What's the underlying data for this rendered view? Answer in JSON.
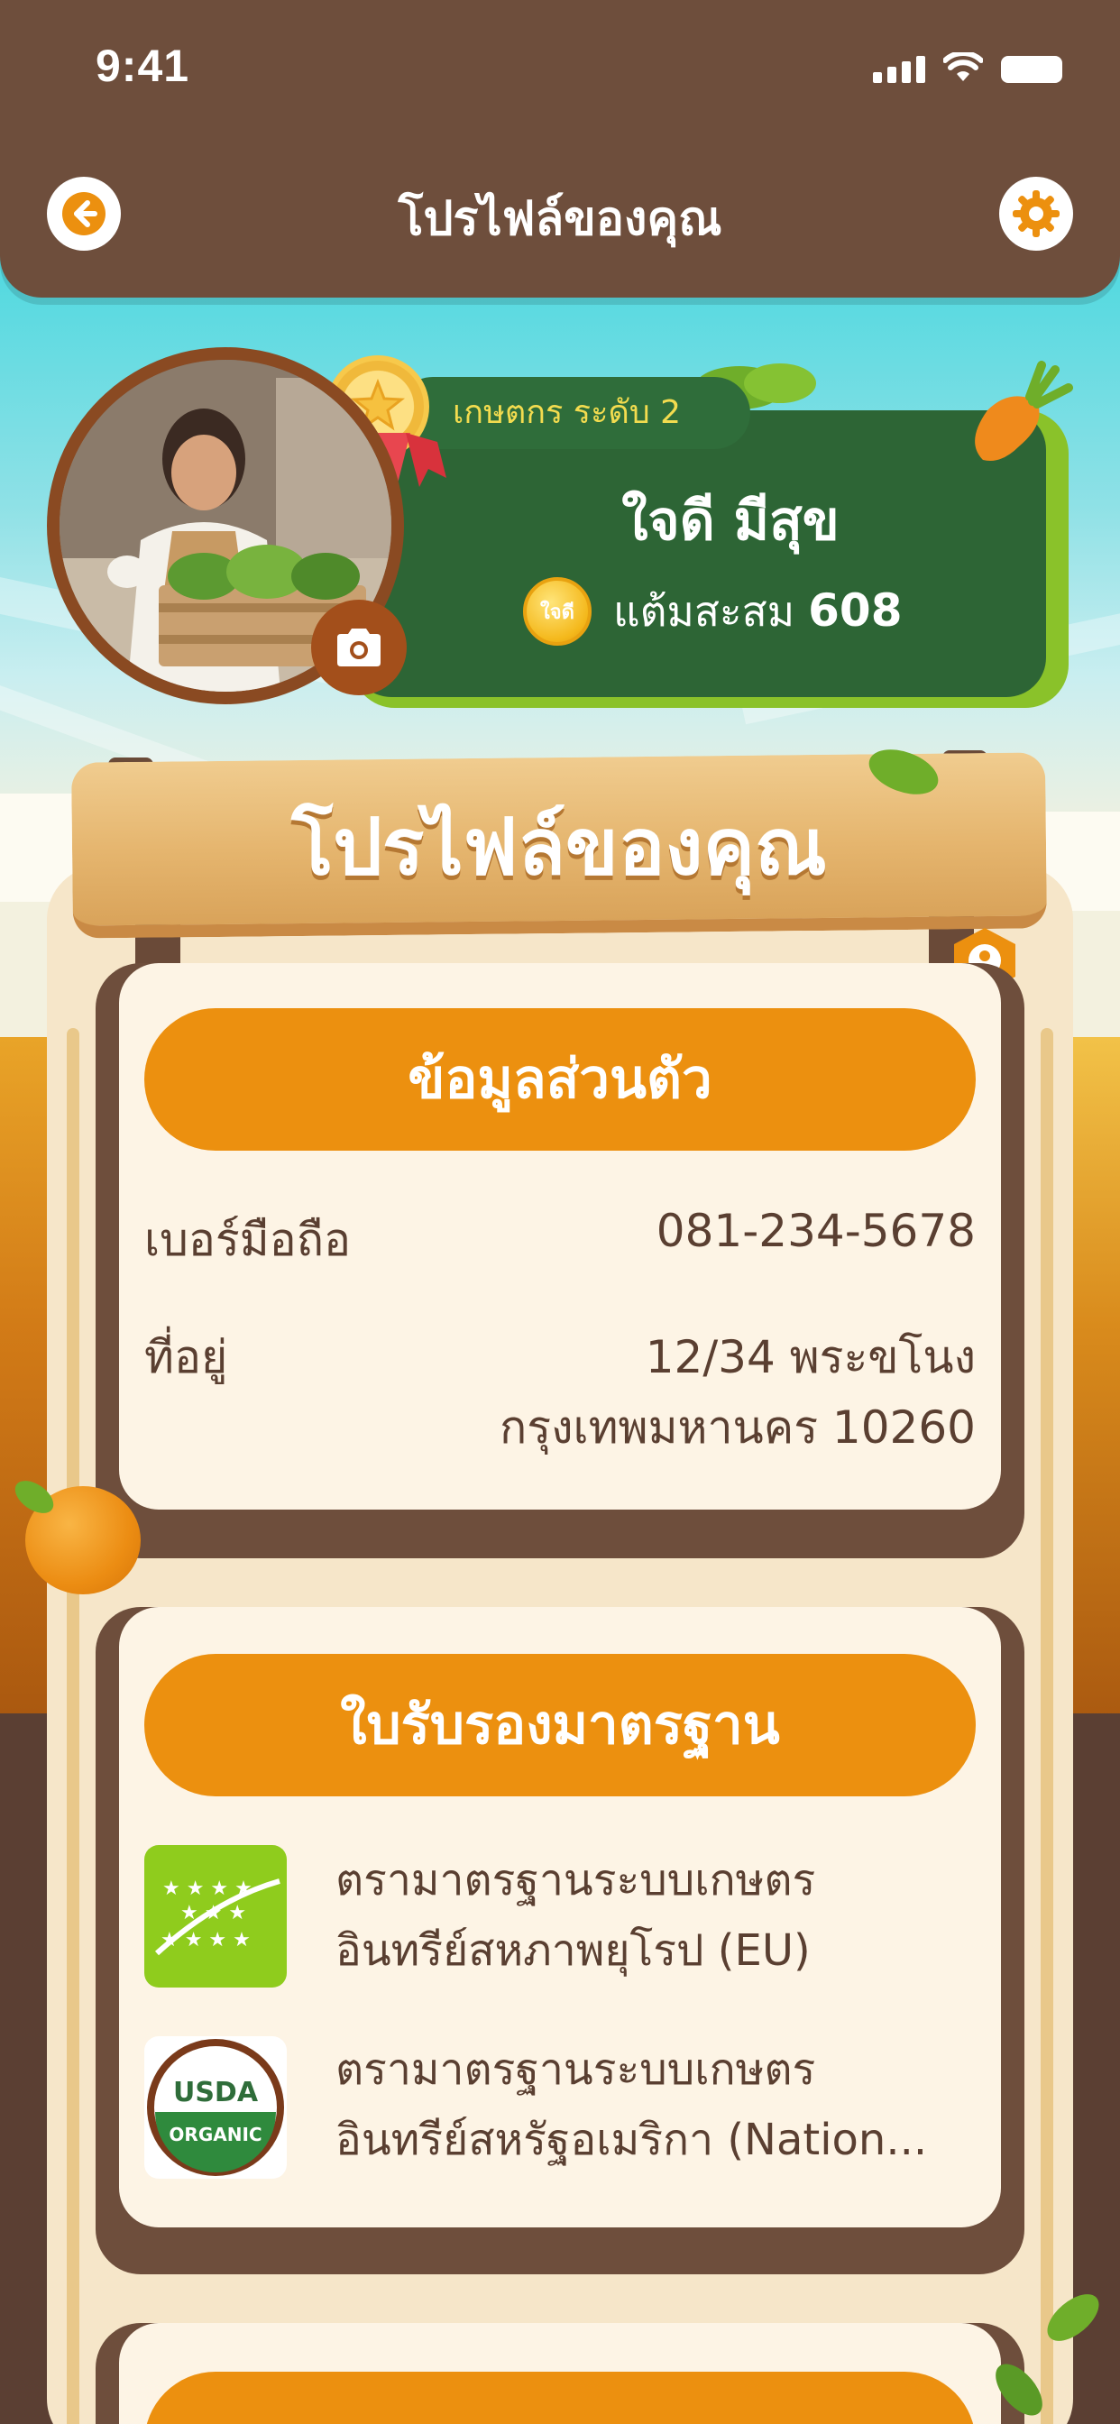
{
  "status_bar": {
    "time": "9:41"
  },
  "header": {
    "title": "โปรไฟล์ของคุณ"
  },
  "profile": {
    "level": "เกษตกร ระดับ 2",
    "name": "ใจดี มีสุข",
    "points_label": "แต้มสะสม",
    "points_value": "608",
    "coin_text": "ใจดี"
  },
  "sign": {
    "title": "โปรไฟล์ของคุณ"
  },
  "personal_info": {
    "title": "ข้อมูลส่วนตัว",
    "phone_label": "เบอร์มือถือ",
    "phone_value": "081-234-5678",
    "address_label": "ที่อยู่",
    "address_line1": "12/34 พระขโนง",
    "address_line2": "กรุงเทพมหานคร 10260"
  },
  "certificates": {
    "title": "ใบรับรองมาตรฐาน",
    "items": [
      {
        "line1": "ตรามาตรฐานระบบเกษตร",
        "line2": "อินทรีย์สหภาพยุโรป (EU)",
        "logo": "eu-organic-logo"
      },
      {
        "line1": "ตรามาตรฐานระบบเกษตร",
        "line2": "อินทรีย์สหรัฐอเมริกา (Nation...",
        "logo": "usda-organic-logo",
        "logo_top": "USDA",
        "logo_bottom": "ORGANIC"
      }
    ]
  },
  "colors": {
    "header_brown": "#6e4e3c",
    "accent_orange": "#ec900f",
    "banner_green": "#2d6535",
    "card_cream": "#fdf4e5"
  }
}
